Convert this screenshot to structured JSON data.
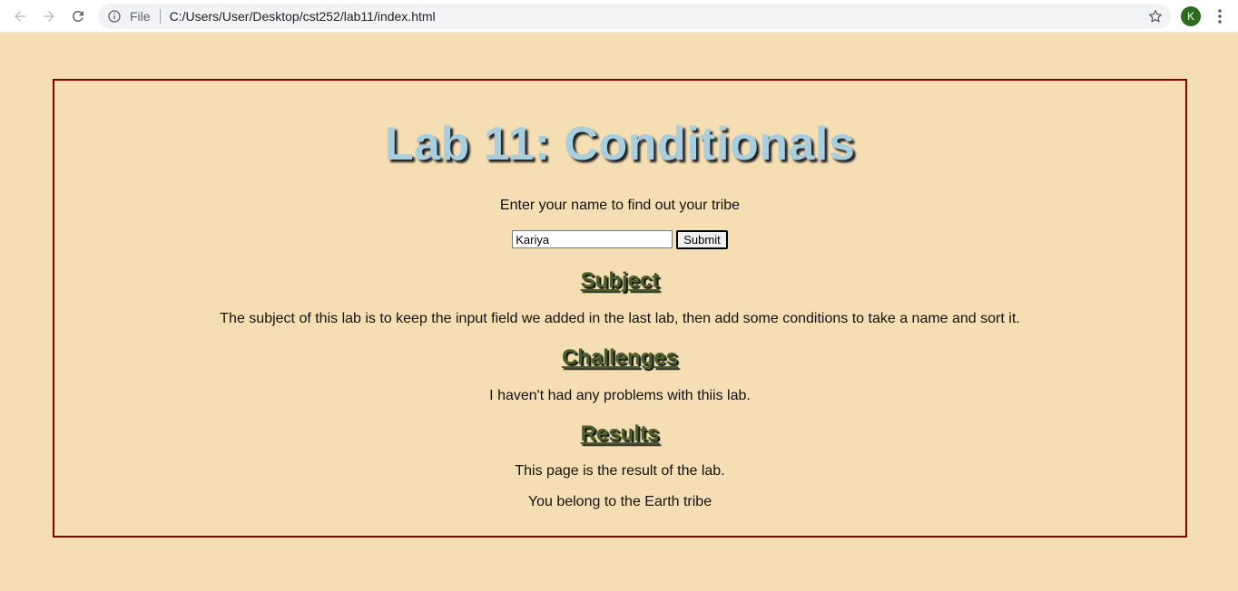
{
  "browser": {
    "file_label": "File",
    "url": "C:/Users/User/Desktop/cst252/lab11/index.html",
    "profile_initial": "K"
  },
  "page": {
    "title": "Lab 11: Conditionals",
    "prompt": "Enter your name to find out your tribe",
    "name_input_value": "Kariya",
    "submit_label": "Submit",
    "sections": {
      "subject": {
        "heading": "Subject",
        "text": "The subject of this lab is to keep the input field we added in the last lab, then add some conditions to take a name and sort it."
      },
      "challenges": {
        "heading": "Challenges",
        "text": "I haven't had any problems with thiis lab."
      },
      "results": {
        "heading": "Results",
        "text": "This page is the result of the lab.",
        "tribe_message": "You belong to the Earth tribe"
      }
    }
  },
  "colors": {
    "page_background": "#f5deb3",
    "border": "#8b0000",
    "title": "#a7cfe0",
    "heading": "#4a5e2a"
  }
}
